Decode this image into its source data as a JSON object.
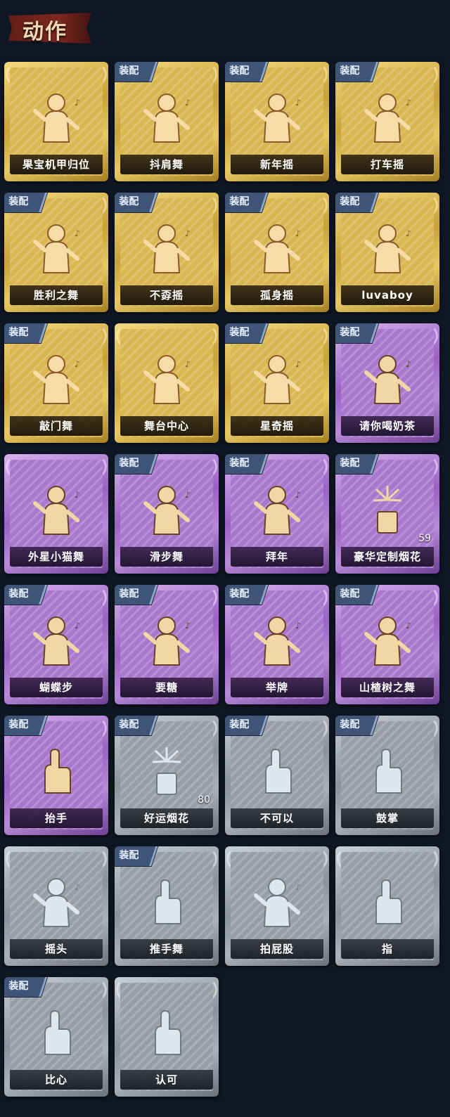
{
  "header": {
    "title": "动作"
  },
  "badge_label": "装配",
  "cards": [
    {
      "label": "果宝机甲归位",
      "tier": "gold",
      "equipped": false,
      "icon": "arms-on-hips-pose-icon"
    },
    {
      "label": "抖肩舞",
      "tier": "gold",
      "equipped": true,
      "icon": "shoulder-shake-pose-icon"
    },
    {
      "label": "新年摇",
      "tier": "gold",
      "equipped": true,
      "icon": "new-year-sway-pose-icon"
    },
    {
      "label": "打车摇",
      "tier": "gold",
      "equipped": true,
      "icon": "taxi-sway-pose-icon"
    },
    {
      "label": "胜利之舞",
      "tier": "gold",
      "equipped": true,
      "icon": "victory-dance-pose-icon"
    },
    {
      "label": "不孬摇",
      "tier": "gold",
      "equipped": true,
      "icon": "dance-pose-icon"
    },
    {
      "label": "孤身摇",
      "tier": "gold",
      "equipped": true,
      "icon": "solo-sway-pose-icon"
    },
    {
      "label": "luvaboy",
      "tier": "gold",
      "equipped": true,
      "icon": "luvaboy-pose-icon"
    },
    {
      "label": "敲门舞",
      "tier": "gold",
      "equipped": true,
      "icon": "knock-dance-pose-icon"
    },
    {
      "label": "舞台中心",
      "tier": "gold",
      "equipped": false,
      "icon": "center-stage-pose-icon"
    },
    {
      "label": "星奇摇",
      "tier": "gold",
      "equipped": true,
      "icon": "star-sway-pose-icon"
    },
    {
      "label": "请你喝奶茶",
      "tier": "purple",
      "equipped": true,
      "icon": "milk-tea-pose-icon"
    },
    {
      "label": "外星小猫舞",
      "tier": "purple",
      "equipped": false,
      "icon": "alien-cat-dance-pose-icon"
    },
    {
      "label": "滑步舞",
      "tier": "purple",
      "equipped": true,
      "icon": "slide-dance-pose-icon"
    },
    {
      "label": "拜年",
      "tier": "purple",
      "equipped": true,
      "icon": "greeting-pose-icon"
    },
    {
      "label": "豪华定制烟花",
      "tier": "purple",
      "equipped": true,
      "icon": "fireworks-box-icon",
      "count": "59"
    },
    {
      "label": "蝴蝶步",
      "tier": "purple",
      "equipped": true,
      "icon": "butterfly-step-pose-icon"
    },
    {
      "label": "要糖",
      "tier": "purple",
      "equipped": true,
      "icon": "ask-candy-pose-icon"
    },
    {
      "label": "举牌",
      "tier": "purple",
      "equipped": true,
      "icon": "hold-sign-pose-icon"
    },
    {
      "label": "山楂树之舞",
      "tier": "purple",
      "equipped": true,
      "icon": "hawthorn-dance-pose-icon"
    },
    {
      "label": "抬手",
      "tier": "purple",
      "equipped": true,
      "icon": "raise-hand-pose-icon"
    },
    {
      "label": "好运烟花",
      "tier": "grey",
      "equipped": true,
      "icon": "firework-can-icon",
      "count": "80"
    },
    {
      "label": "不可以",
      "tier": "grey",
      "equipped": true,
      "icon": "finger-wag-icon"
    },
    {
      "label": "鼓掌",
      "tier": "grey",
      "equipped": true,
      "icon": "clap-hands-icon"
    },
    {
      "label": "摇头",
      "tier": "grey",
      "equipped": false,
      "icon": "shake-head-pose-icon"
    },
    {
      "label": "推手舞",
      "tier": "grey",
      "equipped": true,
      "icon": "push-hand-dance-pose-icon"
    },
    {
      "label": "拍屁股",
      "tier": "grey",
      "equipped": false,
      "icon": "pat-butt-pose-icon"
    },
    {
      "label": "指",
      "tier": "grey",
      "equipped": false,
      "icon": "point-hand-icon"
    },
    {
      "label": "比心",
      "tier": "grey",
      "equipped": true,
      "icon": "finger-heart-icon"
    },
    {
      "label": "认可",
      "tier": "grey",
      "equipped": false,
      "icon": "thumbs-up-icon"
    }
  ]
}
